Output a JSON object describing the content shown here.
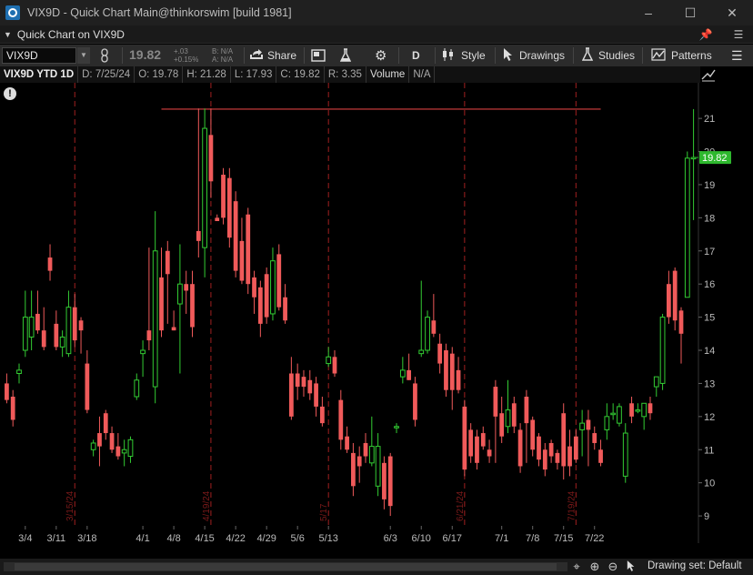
{
  "window": {
    "title": "VIX9D - Quick Chart Main@thinkorswim [build 1981]",
    "minimize": "–",
    "maximize": "☐",
    "close": "✕"
  },
  "header": {
    "title": "Quick Chart on VIX9D",
    "pin_icon": "pin-icon",
    "menu_icon": "menu-icon"
  },
  "toolbar": {
    "symbol": "VIX9D",
    "last_price": "19.82",
    "change": "+.03",
    "change_pct": "+0.15%",
    "bid": "B: N/A",
    "ask": "A: N/A",
    "share_label": "Share",
    "aggregation": "D",
    "style_label": "Style",
    "drawings_label": "Drawings",
    "studies_label": "Studies",
    "patterns_label": "Patterns"
  },
  "infobar": {
    "symbol_period": "VIX9D YTD 1D",
    "date": "D: 7/25/24",
    "open": "O: 19.78",
    "high": "H: 21.28",
    "low": "L: 17.93",
    "close": "C: 19.82",
    "range": "R: 3.35",
    "volume_label": "Volume",
    "volume_value": "N/A"
  },
  "bottombar": {
    "drawing_set": "Drawing set: Default"
  },
  "colors": {
    "up": "#33cc33",
    "down": "#f05a5a",
    "price_tag": "#2eb82e",
    "resistance": "#d94040",
    "event_line": "#a01f1f"
  },
  "chart_data": {
    "type": "candlestick",
    "title": "",
    "xlabel": "",
    "ylabel": "",
    "ylim": [
      8.7,
      21.8
    ],
    "y_ticks": [
      9,
      10,
      11,
      12,
      13,
      14,
      15,
      16,
      17,
      18,
      19,
      20,
      21
    ],
    "x_ticks": [
      {
        "label": "3/4",
        "i": 3
      },
      {
        "label": "3/11",
        "i": 8
      },
      {
        "label": "3/18",
        "i": 13
      },
      {
        "label": "4/1",
        "i": 22
      },
      {
        "label": "4/8",
        "i": 27
      },
      {
        "label": "4/15",
        "i": 32
      },
      {
        "label": "4/22",
        "i": 37
      },
      {
        "label": "4/29",
        "i": 42
      },
      {
        "label": "5/6",
        "i": 47
      },
      {
        "label": "5/13",
        "i": 52
      },
      {
        "label": "6/3",
        "i": 62
      },
      {
        "label": "6/10",
        "i": 67
      },
      {
        "label": "6/17",
        "i": 72
      },
      {
        "label": "7/1",
        "i": 80
      },
      {
        "label": "7/8",
        "i": 85
      },
      {
        "label": "7/15",
        "i": 90
      },
      {
        "label": "7/22",
        "i": 95
      }
    ],
    "event_lines": [
      {
        "label": "3/15/24",
        "i": 11
      },
      {
        "label": "4/19/24",
        "i": 33
      },
      {
        "label": "5/17",
        "i": 52
      },
      {
        "label": "6/21/24",
        "i": 74
      },
      {
        "label": "7/19/24",
        "i": 92
      }
    ],
    "resistance_line": {
      "value": 21.28,
      "from_i": 25,
      "to_i": 96
    },
    "last_price_tag": "19.82",
    "candles": [
      {
        "o": 13.0,
        "h": 13.3,
        "l": 12.4,
        "c": 12.5
      },
      {
        "o": 12.6,
        "h": 12.8,
        "l": 11.7,
        "c": 11.9
      },
      {
        "o": 13.3,
        "h": 13.6,
        "l": 13.0,
        "c": 13.4
      },
      {
        "o": 14.0,
        "h": 15.8,
        "l": 13.8,
        "c": 15.0
      },
      {
        "o": 14.4,
        "h": 15.8,
        "l": 14.0,
        "c": 15.0
      },
      {
        "o": 15.1,
        "h": 15.8,
        "l": 14.5,
        "c": 14.6
      },
      {
        "o": 14.6,
        "h": 15.3,
        "l": 14.0,
        "c": 14.1
      },
      {
        "o": 16.8,
        "h": 17.2,
        "l": 16.1,
        "c": 16.4
      },
      {
        "o": 14.8,
        "h": 15.2,
        "l": 14.0,
        "c": 14.1
      },
      {
        "o": 14.1,
        "h": 14.6,
        "l": 13.8,
        "c": 14.4
      },
      {
        "o": 13.9,
        "h": 15.8,
        "l": 13.8,
        "c": 15.3
      },
      {
        "o": 15.3,
        "h": 15.7,
        "l": 14.1,
        "c": 14.3
      },
      {
        "o": 14.9,
        "h": 15.0,
        "l": 13.9,
        "c": 14.6
      },
      {
        "o": 13.6,
        "h": 14.0,
        "l": 12.1,
        "c": 12.2
      },
      {
        "o": 11.0,
        "h": 11.3,
        "l": 10.8,
        "c": 11.2
      },
      {
        "o": 11.5,
        "h": 12.0,
        "l": 10.5,
        "c": 11.1
      },
      {
        "o": 12.1,
        "h": 12.2,
        "l": 11.3,
        "c": 11.5
      },
      {
        "o": 11.5,
        "h": 11.7,
        "l": 10.9,
        "c": 11.0
      },
      {
        "o": 11.1,
        "h": 11.5,
        "l": 10.7,
        "c": 10.8
      },
      {
        "o": 10.9,
        "h": 11.3,
        "l": 10.5,
        "c": 11.0
      },
      {
        "o": 10.8,
        "h": 11.4,
        "l": 10.6,
        "c": 11.3
      },
      {
        "o": 12.6,
        "h": 13.3,
        "l": 12.5,
        "c": 13.1
      },
      {
        "o": 13.9,
        "h": 14.3,
        "l": 13.2,
        "c": 14.0
      },
      {
        "o": 14.6,
        "h": 17.1,
        "l": 14.0,
        "c": 14.3
      },
      {
        "o": 12.9,
        "h": 18.2,
        "l": 12.4,
        "c": 17.0
      },
      {
        "o": 16.2,
        "h": 17.1,
        "l": 14.4,
        "c": 14.6
      },
      {
        "o": 17.0,
        "h": 17.3,
        "l": 14.8,
        "c": 16.3
      },
      {
        "o": 14.7,
        "h": 15.2,
        "l": 14.6,
        "c": 14.6
      },
      {
        "o": 15.4,
        "h": 17.2,
        "l": 13.3,
        "c": 16.0
      },
      {
        "o": 16.0,
        "h": 16.4,
        "l": 15.1,
        "c": 15.8
      },
      {
        "o": 16.0,
        "h": 16.4,
        "l": 14.4,
        "c": 14.7
      },
      {
        "o": 17.6,
        "h": 21.3,
        "l": 16.8,
        "c": 17.3
      },
      {
        "o": 17.1,
        "h": 21.3,
        "l": 16.2,
        "c": 20.7
      },
      {
        "o": 20.5,
        "h": 21.3,
        "l": 18.6,
        "c": 19.1
      },
      {
        "o": 18.0,
        "h": 18.1,
        "l": 17.9,
        "c": 17.9
      },
      {
        "o": 19.3,
        "h": 19.5,
        "l": 17.8,
        "c": 18.0
      },
      {
        "o": 19.2,
        "h": 19.5,
        "l": 17.1,
        "c": 17.4
      },
      {
        "o": 18.5,
        "h": 18.8,
        "l": 16.2,
        "c": 16.4
      },
      {
        "o": 17.3,
        "h": 18.0,
        "l": 16.0,
        "c": 16.1
      },
      {
        "o": 18.1,
        "h": 18.3,
        "l": 15.7,
        "c": 16.0
      },
      {
        "o": 16.2,
        "h": 16.4,
        "l": 15.1,
        "c": 15.6
      },
      {
        "o": 15.9,
        "h": 16.1,
        "l": 14.4,
        "c": 14.8
      },
      {
        "o": 16.3,
        "h": 16.5,
        "l": 14.8,
        "c": 15.0
      },
      {
        "o": 15.1,
        "h": 17.1,
        "l": 14.9,
        "c": 16.7
      },
      {
        "o": 16.9,
        "h": 17.2,
        "l": 15.2,
        "c": 15.3
      },
      {
        "o": 15.6,
        "h": 16.0,
        "l": 14.8,
        "c": 14.9
      },
      {
        "o": 13.3,
        "h": 13.8,
        "l": 11.9,
        "c": 12.0
      },
      {
        "o": 13.3,
        "h": 13.6,
        "l": 12.5,
        "c": 12.9
      },
      {
        "o": 13.2,
        "h": 13.4,
        "l": 12.6,
        "c": 12.9
      },
      {
        "o": 13.1,
        "h": 13.4,
        "l": 12.5,
        "c": 12.7
      },
      {
        "o": 13.0,
        "h": 13.2,
        "l": 12.0,
        "c": 12.3
      },
      {
        "o": 12.3,
        "h": 12.6,
        "l": 11.7,
        "c": 11.8
      },
      {
        "o": 13.6,
        "h": 14.1,
        "l": 13.5,
        "c": 13.8
      },
      {
        "o": 13.8,
        "h": 14.0,
        "l": 13.2,
        "c": 13.3
      },
      {
        "o": 12.5,
        "h": 12.8,
        "l": 11.0,
        "c": 11.3
      },
      {
        "o": 11.4,
        "h": 11.7,
        "l": 10.9,
        "c": 11.0
      },
      {
        "o": 10.9,
        "h": 11.2,
        "l": 9.6,
        "c": 9.9
      },
      {
        "o": 10.8,
        "h": 11.1,
        "l": 10.0,
        "c": 10.5
      },
      {
        "o": 11.2,
        "h": 11.5,
        "l": 10.6,
        "c": 10.8
      },
      {
        "o": 10.6,
        "h": 12.0,
        "l": 10.5,
        "c": 11.1
      },
      {
        "o": 9.9,
        "h": 11.5,
        "l": 9.6,
        "c": 11.1
      },
      {
        "o": 10.6,
        "h": 10.8,
        "l": 9.2,
        "c": 9.5
      },
      {
        "o": 10.8,
        "h": 10.9,
        "l": 9.0,
        "c": 9.3
      },
      {
        "o": 11.7,
        "h": 11.8,
        "l": 11.5,
        "c": 11.7
      },
      {
        "o": 13.2,
        "h": 13.8,
        "l": 13.0,
        "c": 13.4
      },
      {
        "o": 13.4,
        "h": 13.9,
        "l": 13.1,
        "c": 13.1
      },
      {
        "o": 13.0,
        "h": 13.2,
        "l": 11.7,
        "c": 11.9
      },
      {
        "o": 13.9,
        "h": 16.1,
        "l": 13.8,
        "c": 14.0
      },
      {
        "o": 14.0,
        "h": 15.2,
        "l": 13.9,
        "c": 15.0
      },
      {
        "o": 14.9,
        "h": 15.7,
        "l": 14.4,
        "c": 14.5
      },
      {
        "o": 14.2,
        "h": 14.5,
        "l": 13.3,
        "c": 13.6
      },
      {
        "o": 14.0,
        "h": 14.2,
        "l": 12.6,
        "c": 12.8
      },
      {
        "o": 13.9,
        "h": 14.1,
        "l": 12.2,
        "c": 12.8
      },
      {
        "o": 13.4,
        "h": 13.8,
        "l": 12.7,
        "c": 12.8
      },
      {
        "o": 12.3,
        "h": 12.5,
        "l": 10.2,
        "c": 10.4
      },
      {
        "o": 11.6,
        "h": 11.8,
        "l": 10.6,
        "c": 10.8
      },
      {
        "o": 11.4,
        "h": 11.6,
        "l": 10.4,
        "c": 10.6
      },
      {
        "o": 11.5,
        "h": 11.7,
        "l": 11.0,
        "c": 11.1
      },
      {
        "o": 11.0,
        "h": 11.3,
        "l": 10.6,
        "c": 10.8
      },
      {
        "o": 12.9,
        "h": 13.1,
        "l": 10.6,
        "c": 12.0
      },
      {
        "o": 12.1,
        "h": 12.6,
        "l": 11.2,
        "c": 11.4
      },
      {
        "o": 11.7,
        "h": 13.1,
        "l": 11.5,
        "c": 12.2
      },
      {
        "o": 12.4,
        "h": 12.6,
        "l": 11.5,
        "c": 11.7
      },
      {
        "o": 11.6,
        "h": 11.8,
        "l": 10.3,
        "c": 10.5
      },
      {
        "o": 12.6,
        "h": 12.8,
        "l": 10.6,
        "c": 11.8
      },
      {
        "o": 11.9,
        "h": 12.0,
        "l": 10.8,
        "c": 11.0
      },
      {
        "o": 11.4,
        "h": 11.5,
        "l": 10.5,
        "c": 10.7
      },
      {
        "o": 11.0,
        "h": 11.2,
        "l": 10.2,
        "c": 10.4
      },
      {
        "o": 11.2,
        "h": 11.3,
        "l": 10.6,
        "c": 10.8
      },
      {
        "o": 10.9,
        "h": 11.0,
        "l": 10.4,
        "c": 10.6
      },
      {
        "o": 12.1,
        "h": 12.4,
        "l": 10.1,
        "c": 10.5
      },
      {
        "o": 11.1,
        "h": 11.6,
        "l": 10.2,
        "c": 10.5
      },
      {
        "o": 11.4,
        "h": 11.6,
        "l": 10.6,
        "c": 10.7
      },
      {
        "o": 11.6,
        "h": 12.2,
        "l": 10.8,
        "c": 11.8
      },
      {
        "o": 11.9,
        "h": 12.2,
        "l": 10.5,
        "c": 11.6
      },
      {
        "o": 11.5,
        "h": 11.7,
        "l": 11.0,
        "c": 11.2
      },
      {
        "o": 11.0,
        "h": 11.3,
        "l": 10.5,
        "c": 10.6
      },
      {
        "o": 11.6,
        "h": 12.4,
        "l": 11.3,
        "c": 12.0
      },
      {
        "o": 12.1,
        "h": 12.4,
        "l": 11.9,
        "c": 12.1
      },
      {
        "o": 11.8,
        "h": 12.4,
        "l": 11.7,
        "c": 12.3
      },
      {
        "o": 10.2,
        "h": 11.8,
        "l": 10.0,
        "c": 11.5
      },
      {
        "o": 12.4,
        "h": 12.6,
        "l": 11.8,
        "c": 12.0
      },
      {
        "o": 12.2,
        "h": 12.4,
        "l": 12.1,
        "c": 12.2
      },
      {
        "o": 12.0,
        "h": 12.4,
        "l": 11.6,
        "c": 12.4
      },
      {
        "o": 12.4,
        "h": 12.6,
        "l": 11.9,
        "c": 12.1
      },
      {
        "o": 12.9,
        "h": 13.2,
        "l": 12.6,
        "c": 13.2
      },
      {
        "o": 13.0,
        "h": 15.1,
        "l": 12.8,
        "c": 15.0
      },
      {
        "o": 16.0,
        "h": 16.4,
        "l": 14.8,
        "c": 15.0
      },
      {
        "o": 16.4,
        "h": 16.5,
        "l": 14.6,
        "c": 14.9
      },
      {
        "o": 15.2,
        "h": 15.3,
        "l": 13.6,
        "c": 14.5
      },
      {
        "o": 15.6,
        "h": 20.0,
        "l": 15.6,
        "c": 19.8
      },
      {
        "o": 19.78,
        "h": 21.28,
        "l": 17.93,
        "c": 19.82
      }
    ]
  }
}
